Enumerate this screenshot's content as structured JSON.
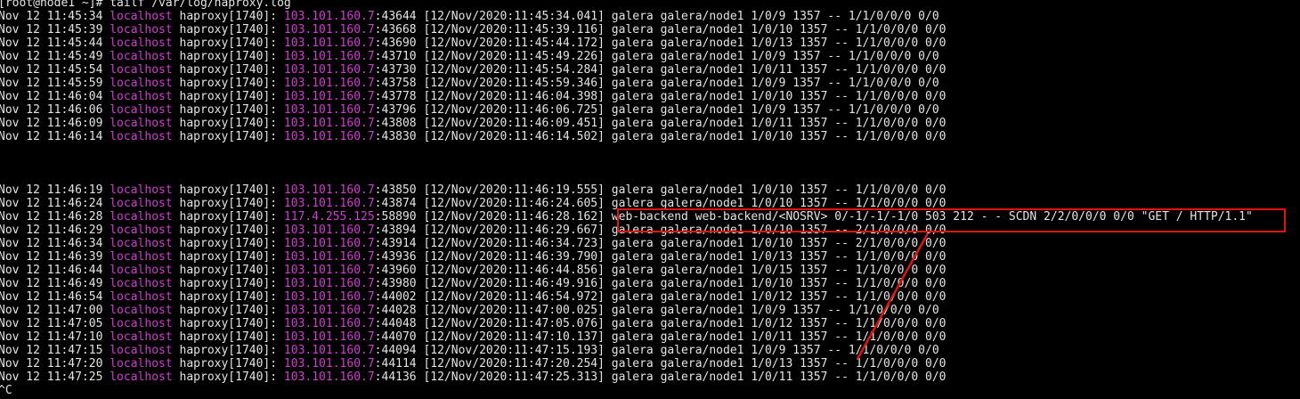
{
  "terminal": {
    "prompt": "[root@node1 ~]# ",
    "command": "tailf /var/log/haproxy.log",
    "ctrl_c": "^C",
    "lines": [
      {
        "pre": "Nov 12 11:45:34 ",
        "host": "localhost",
        "proc": " haproxy[1740]: ",
        "ip": "103.101.160.7",
        "port": ":43644",
        "rest": " [12/Nov/2020:11:45:34.041] galera galera/node1 1/0/9 1357 -- 1/1/0/0/0 0/0"
      },
      {
        "pre": "Nov 12 11:45:39 ",
        "host": "localhost",
        "proc": " haproxy[1740]: ",
        "ip": "103.101.160.7",
        "port": ":43668",
        "rest": " [12/Nov/2020:11:45:39.116] galera galera/node1 1/0/10 1357 -- 1/1/0/0/0 0/0"
      },
      {
        "pre": "Nov 12 11:45:44 ",
        "host": "localhost",
        "proc": " haproxy[1740]: ",
        "ip": "103.101.160.7",
        "port": ":43690",
        "rest": " [12/Nov/2020:11:45:44.172] galera galera/node1 1/0/13 1357 -- 1/1/0/0/0 0/0"
      },
      {
        "pre": "Nov 12 11:45:49 ",
        "host": "localhost",
        "proc": " haproxy[1740]: ",
        "ip": "103.101.160.7",
        "port": ":43710",
        "rest": " [12/Nov/2020:11:45:49.226] galera galera/node1 1/0/9 1357 -- 1/1/0/0/0 0/0"
      },
      {
        "pre": "Nov 12 11:45:54 ",
        "host": "localhost",
        "proc": " haproxy[1740]: ",
        "ip": "103.101.160.7",
        "port": ":43730",
        "rest": " [12/Nov/2020:11:45:54.284] galera galera/node1 1/0/11 1357 -- 1/1/0/0/0 0/0"
      },
      {
        "pre": "Nov 12 11:45:59 ",
        "host": "localhost",
        "proc": " haproxy[1740]: ",
        "ip": "103.101.160.7",
        "port": ":43758",
        "rest": " [12/Nov/2020:11:45:59.346] galera galera/node1 1/0/9 1357 -- 1/1/0/0/0 0/0"
      },
      {
        "pre": "Nov 12 11:46:04 ",
        "host": "localhost",
        "proc": " haproxy[1740]: ",
        "ip": "103.101.160.7",
        "port": ":43778",
        "rest": " [12/Nov/2020:11:46:04.398] galera galera/node1 1/0/10 1357 -- 1/1/0/0/0 0/0"
      },
      {
        "pre": "Nov 12 11:46:06 ",
        "host": "localhost",
        "proc": " haproxy[1740]: ",
        "ip": "103.101.160.7",
        "port": ":43796",
        "rest": " [12/Nov/2020:11:46:06.725] galera galera/node1 1/0/9 1357 -- 1/1/0/0/0 0/0"
      },
      {
        "pre": "Nov 12 11:46:09 ",
        "host": "localhost",
        "proc": " haproxy[1740]: ",
        "ip": "103.101.160.7",
        "port": ":43808",
        "rest": " [12/Nov/2020:11:46:09.451] galera galera/node1 1/0/11 1357 -- 1/1/0/0/0 0/0"
      },
      {
        "pre": "Nov 12 11:46:14 ",
        "host": "localhost",
        "proc": " haproxy[1740]: ",
        "ip": "103.101.160.7",
        "port": ":43830",
        "rest": " [12/Nov/2020:11:46:14.502] galera galera/node1 1/0/10 1357 -- 1/1/0/0/0 0/0"
      },
      {
        "pre": "",
        "host": "",
        "proc": "",
        "ip": "",
        "port": "",
        "rest": ""
      },
      {
        "pre": "",
        "host": "",
        "proc": "",
        "ip": "",
        "port": "",
        "rest": ""
      },
      {
        "pre": "",
        "host": "",
        "proc": "",
        "ip": "",
        "port": "",
        "rest": ""
      },
      {
        "pre": "Nov 12 11:46:19 ",
        "host": "localhost",
        "proc": " haproxy[1740]: ",
        "ip": "103.101.160.7",
        "port": ":43850",
        "rest": " [12/Nov/2020:11:46:19.555] galera galera/node1 1/0/10 1357 -- 1/1/0/0/0 0/0"
      },
      {
        "pre": "Nov 12 11:46:24 ",
        "host": "localhost",
        "proc": " haproxy[1740]: ",
        "ip": "103.101.160.7",
        "port": ":43874",
        "rest": " [12/Nov/2020:11:46:24.605] galera galera/node1 1/0/10 1357 -- 1/1/0/0/0 0/0"
      },
      {
        "pre": "Nov 12 11:46:28 ",
        "host": "localhost",
        "proc": " haproxy[1740]: ",
        "ip": "117.4.255.125",
        "port": ":58890",
        "rest": " [12/Nov/2020:11:46:28.162] web-backend web-backend/<NOSRV> 0/-1/-1/-1/0 503 212 - - SCDN 2/2/0/0/0 0/0 \"GET / HTTP/1.1\""
      },
      {
        "pre": "Nov 12 11:46:29 ",
        "host": "localhost",
        "proc": " haproxy[1740]: ",
        "ip": "103.101.160.7",
        "port": ":43894",
        "rest": " [12/Nov/2020:11:46:29.667] galera galera/node1 1/0/10 1357 -- 2/1/0/0/0 0/0"
      },
      {
        "pre": "Nov 12 11:46:34 ",
        "host": "localhost",
        "proc": " haproxy[1740]: ",
        "ip": "103.101.160.7",
        "port": ":43914",
        "rest": " [12/Nov/2020:11:46:34.723] galera galera/node1 1/0/10 1357 -- 2/1/0/0/0 0/0"
      },
      {
        "pre": "Nov 12 11:46:39 ",
        "host": "localhost",
        "proc": " haproxy[1740]: ",
        "ip": "103.101.160.7",
        "port": ":43936",
        "rest": " [12/Nov/2020:11:46:39.790] galera galera/node1 1/0/13 1357 -- 1/1/0/0/0 0/0"
      },
      {
        "pre": "Nov 12 11:46:44 ",
        "host": "localhost",
        "proc": " haproxy[1740]: ",
        "ip": "103.101.160.7",
        "port": ":43960",
        "rest": " [12/Nov/2020:11:46:44.856] galera galera/node1 1/0/15 1357 -- 1/1/0/0/0 0/0"
      },
      {
        "pre": "Nov 12 11:46:49 ",
        "host": "localhost",
        "proc": " haproxy[1740]: ",
        "ip": "103.101.160.7",
        "port": ":43980",
        "rest": " [12/Nov/2020:11:46:49.916] galera galera/node1 1/0/10 1357 -- 1/1/0/0/0 0/0"
      },
      {
        "pre": "Nov 12 11:46:54 ",
        "host": "localhost",
        "proc": " haproxy[1740]: ",
        "ip": "103.101.160.7",
        "port": ":44002",
        "rest": " [12/Nov/2020:11:46:54.972] galera galera/node1 1/0/12 1357 -- 1/1/0/0/0 0/0"
      },
      {
        "pre": "Nov 12 11:47:00 ",
        "host": "localhost",
        "proc": " haproxy[1740]: ",
        "ip": "103.101.160.7",
        "port": ":44028",
        "rest": " [12/Nov/2020:11:47:00.025] galera galera/node1 1/0/9 1357 -- 1/1/0/0/0 0/0"
      },
      {
        "pre": "Nov 12 11:47:05 ",
        "host": "localhost",
        "proc": " haproxy[1740]: ",
        "ip": "103.101.160.7",
        "port": ":44048",
        "rest": " [12/Nov/2020:11:47:05.076] galera galera/node1 1/0/12 1357 -- 1/1/0/0/0 0/0"
      },
      {
        "pre": "Nov 12 11:47:10 ",
        "host": "localhost",
        "proc": " haproxy[1740]: ",
        "ip": "103.101.160.7",
        "port": ":44070",
        "rest": " [12/Nov/2020:11:47:10.137] galera galera/node1 1/0/11 1357 -- 1/1/0/0/0 0/0"
      },
      {
        "pre": "Nov 12 11:47:15 ",
        "host": "localhost",
        "proc": " haproxy[1740]: ",
        "ip": "103.101.160.7",
        "port": ":44094",
        "rest": " [12/Nov/2020:11:47:15.193] galera galera/node1 1/0/9 1357 -- 1/1/0/0/0 0/0"
      },
      {
        "pre": "Nov 12 11:47:20 ",
        "host": "localhost",
        "proc": " haproxy[1740]: ",
        "ip": "103.101.160.7",
        "port": ":44114",
        "rest": " [12/Nov/2020:11:47:20.254] galera galera/node1 1/0/13 1357 -- 1/1/0/0/0 0/0"
      },
      {
        "pre": "Nov 12 11:47:25 ",
        "host": "localhost",
        "proc": " haproxy[1740]: ",
        "ip": "103.101.160.7",
        "port": ":44136",
        "rest": " [12/Nov/2020:11:47:25.313] galera galera/node1 1/0/11 1357 -- 1/1/0/0/0 0/0"
      }
    ]
  },
  "colors": {
    "background": "#000000",
    "text": "#e4e4e4",
    "magenta": "#d23cd2",
    "annotation_red": "#e11414"
  }
}
